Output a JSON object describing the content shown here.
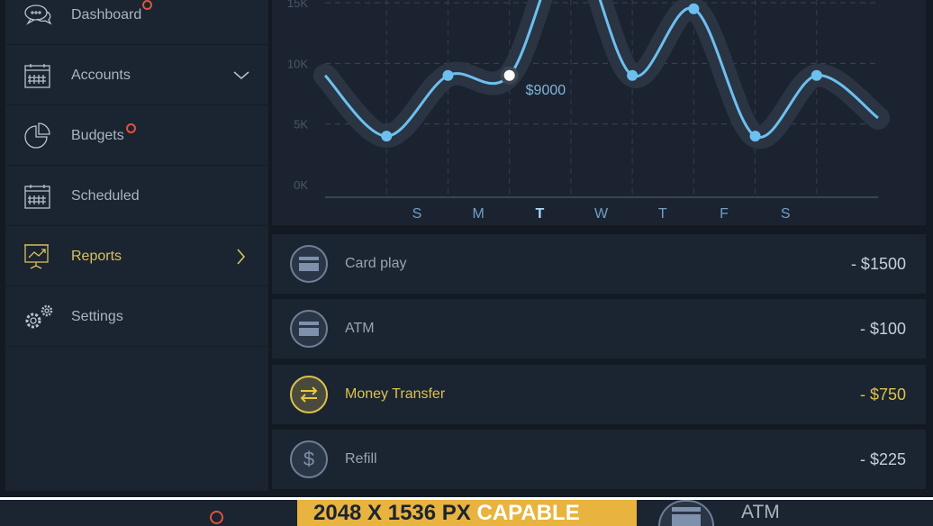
{
  "sidebar": {
    "items": [
      {
        "label": "Dashboard",
        "icon": "chat-bubbles-icon",
        "badge": true
      },
      {
        "label": "Accounts",
        "icon": "calendar-icon",
        "chevron": "down"
      },
      {
        "label": "Budgets",
        "icon": "pie-chart-icon",
        "badge": true
      },
      {
        "label": "Scheduled",
        "icon": "calendar-icon"
      },
      {
        "label": "Reports",
        "icon": "presentation-chart-icon",
        "chevron": "right",
        "active": true
      },
      {
        "label": "Settings",
        "icon": "gears-icon"
      }
    ]
  },
  "chart_data": {
    "type": "line",
    "y_ticks": [
      "0K",
      "5K",
      "10K",
      "15K"
    ],
    "ylim": [
      0,
      15000
    ],
    "x_labels": [
      "S",
      "M",
      "T",
      "W",
      "T",
      "F",
      "S"
    ],
    "selected_label_index": 2,
    "values": [
      9000,
      4000,
      9000,
      9000,
      20000,
      9000,
      14500,
      4000,
      9000,
      5500
    ],
    "highlight_index": 3,
    "highlight_label": "$9000",
    "grid": true,
    "colors": {
      "line": "#6cc0ef",
      "band": "#2a3442",
      "highlight": "#ffffff"
    }
  },
  "transactions": [
    {
      "name": "Card play",
      "amount": "- $1500",
      "icon": "credit-card-icon"
    },
    {
      "name": "ATM",
      "amount": "- $100",
      "icon": "credit-card-icon"
    },
    {
      "name": "Money Transfer",
      "amount": "- $750",
      "icon": "transfer-arrows-icon",
      "highlight": true
    },
    {
      "name": "Refill",
      "amount": "- $225",
      "icon": "dollar-icon",
      "symbol": "$"
    }
  ],
  "bottom": {
    "banner_a": "2048 X 1536 PX ",
    "banner_b": "CAPABLE",
    "item": "ATM"
  },
  "colors": {
    "accent": "#dcc24c",
    "badge": "#e0533a",
    "banner": "#e8b33e"
  }
}
